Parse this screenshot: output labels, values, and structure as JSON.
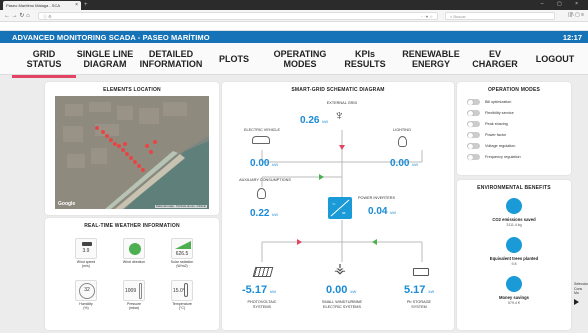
{
  "browser": {
    "tab_title": "Paseo Marítimo Málaga - SCA",
    "search_placeholder": "Buscar",
    "close_glyph": "×",
    "new_tab_glyph": "+",
    "window_controls": "– ▢ ×",
    "back_forward": "← → ↻ ⌂",
    "url_icons": "ⓘ ⚙",
    "bookmark_icons": "··· ♥ ☆",
    "extra_icons": "|||\\ ▢ ≡"
  },
  "app": {
    "title": "ADVANCED MONITORING SCADA - PASEO MARÍTIMO",
    "clock": "12:17",
    "accent": "#1673b8",
    "active_tab_color": "#e24463"
  },
  "menu": [
    {
      "l1": "GRID",
      "l2": "STATUS",
      "active": true
    },
    {
      "l1": "SINGLE LINE",
      "l2": "DIAGRAM"
    },
    {
      "l1": "DETAILED",
      "l2": "INFORMATION"
    },
    {
      "l1": "PLOTS",
      "l2": ""
    },
    {
      "l1": "OPERATING",
      "l2": "MODES"
    },
    {
      "l1": "KPIs",
      "l2": "RESULTS"
    },
    {
      "l1": "RENEWABLE",
      "l2": "ENERGY"
    },
    {
      "l1": "EV",
      "l2": "CHARGER"
    },
    {
      "l1": "LOGOUT",
      "l2": ""
    }
  ],
  "elements_location": {
    "title": "ELEMENTS LOCATION",
    "map_attribution": "Google",
    "map_footer": "Datos del mapa · Términos de uso · Informar"
  },
  "weather": {
    "title": "REAL-TIME WEATHER INFORMATION",
    "items": [
      {
        "value": "3.9",
        "label": "Wind speed",
        "unit": "(m/s)",
        "icon": "wind-speed-icon"
      },
      {
        "value": "",
        "label": "Wind direction",
        "unit": "",
        "icon": "wind-direction-icon"
      },
      {
        "value": "626.5",
        "label": "Solar radiation",
        "unit": "(W/m2)",
        "icon": "solar-radiation-icon"
      },
      {
        "value": "32",
        "label": "Humidity",
        "unit": "(%)",
        "icon": "humidity-icon"
      },
      {
        "value": "1009",
        "label": "Pressure",
        "unit": "(mbar)",
        "icon": "pressure-icon"
      },
      {
        "value": "15.0°",
        "label": "Temperature",
        "unit": "(°C)",
        "icon": "thermometer-icon"
      }
    ]
  },
  "diagram": {
    "title": "SMART-GRID SCHEMATIC DIAGRAM",
    "unit": "kW",
    "external_grid": {
      "label": "EXTERNAL GRID",
      "value": "0.26"
    },
    "electric_vehicle": {
      "label": "ELECTRIC VEHICLE",
      "value": "0.00"
    },
    "lighting": {
      "label": "LIGHTING",
      "value": "0.00"
    },
    "auxiliary": {
      "label": "AUXILIARY CONSUMPTIONS",
      "value": "0.22"
    },
    "inverters": {
      "label": "POWER INVERTERS",
      "value": "0.04"
    },
    "pv": {
      "label1": "PHOTOVOLTAIC",
      "label2": "SYSTEMS",
      "value": "-5.17"
    },
    "wind": {
      "label1": "SMALL WINDTURBINE",
      "label2": "ELECTRIC SYSTEMS",
      "value": "0.00"
    },
    "storage": {
      "label1": "Pb STORAGE",
      "label2": "SYSTEM",
      "value": "5.17"
    }
  },
  "operation_modes": {
    "title": "OPERATION MODES",
    "modes": [
      "Bill optimization",
      "Flexibility service",
      "Peak shaving",
      "Power factor",
      "Voltage regulation",
      "Frequency regulation"
    ]
  },
  "environmental": {
    "title": "ENVIRONMENTAL BENEFITS",
    "items": [
      {
        "title": "CO2 emissions saved",
        "value": "3111.4 kg",
        "icon": "co2-icon"
      },
      {
        "title": "Equivalent trees planted",
        "value": "9.8",
        "icon": "tree-icon"
      },
      {
        "title": "Money savings",
        "value": "579.4 €",
        "icon": "money-icon"
      }
    ]
  },
  "side_note": {
    "lines": [
      "Selecciona",
      "Cons",
      "Mo"
    ]
  }
}
